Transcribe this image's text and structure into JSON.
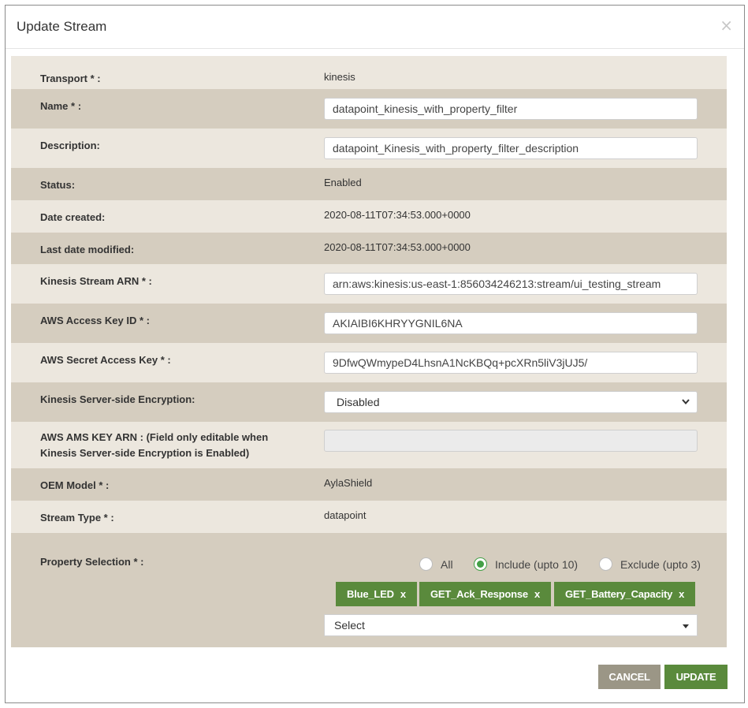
{
  "modal": {
    "title": "Update Stream",
    "close_label": "×"
  },
  "fields": {
    "transport": {
      "label": "Transport * :",
      "value": "kinesis"
    },
    "name": {
      "label": "Name * :",
      "value": "datapoint_kinesis_with_property_filter"
    },
    "description": {
      "label": "Description:",
      "value": "datapoint_Kinesis_with_property_filter_description"
    },
    "status": {
      "label": "Status:",
      "value": "Enabled"
    },
    "date_created": {
      "label": "Date created:",
      "value": "2020-08-11T07:34:53.000+0000"
    },
    "last_modified": {
      "label": "Last date modified:",
      "value": "2020-08-11T07:34:53.000+0000"
    },
    "kinesis_arn": {
      "label": "Kinesis Stream ARN * :",
      "value": "arn:aws:kinesis:us-east-1:856034246213:stream/ui_testing_stream"
    },
    "access_key": {
      "label": "AWS Access Key ID * :",
      "value": "AKIAIBI6KHRYYGNIL6NA"
    },
    "secret_key": {
      "label": "AWS Secret Access Key * :",
      "value": "9DfwQWmypeD4LhsnA1NcKBQq+pcXRn5liV3jUJ5/"
    },
    "encryption": {
      "label": "Kinesis Server-side Encryption:",
      "value": "Disabled"
    },
    "ams_key": {
      "label_line1": "AWS AMS KEY ARN : (Field only editable when",
      "label_line2": "Kinesis Server-side Encryption is Enabled)",
      "value": ""
    },
    "oem_model": {
      "label": "OEM Model * :",
      "value": "AylaShield"
    },
    "stream_type": {
      "label": "Stream Type * :",
      "value": "datapoint"
    },
    "property_selection": {
      "label": "Property Selection * :",
      "options": [
        "All",
        "Include (upto 10)",
        "Exclude (upto 3)"
      ],
      "selected": "Include (upto 10)",
      "chips": [
        "Blue_LED",
        "GET_Ack_Response",
        "GET_Battery_Capacity"
      ],
      "chip_remove": "x",
      "select_value": "Select"
    }
  },
  "footer": {
    "cancel_label": "CANCEL",
    "update_label": "UPDATE"
  },
  "colors": {
    "row_light": "#ece7de",
    "row_dark": "#d5cdbf",
    "accent_green": "#5a8a3c",
    "cancel_gray": "#9b9686"
  }
}
